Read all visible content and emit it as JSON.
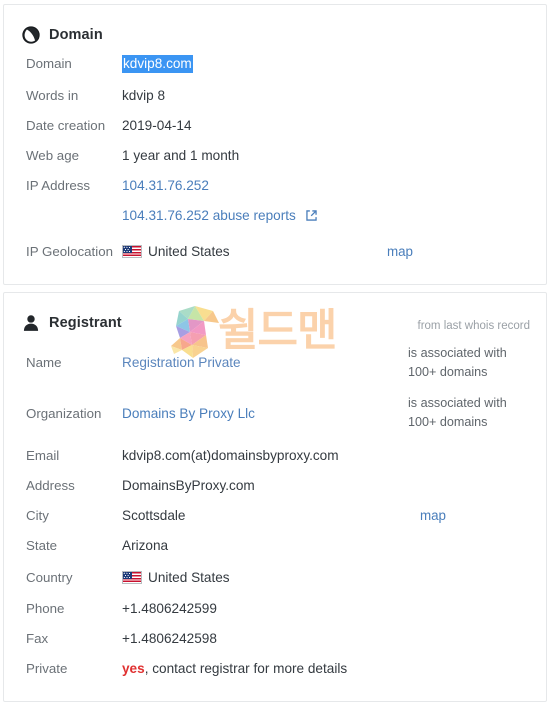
{
  "domain_section": {
    "icon": "globe-icon",
    "title": "Domain",
    "rows": [
      {
        "label": "Domain",
        "value": "kdvip8.com",
        "style": "selected"
      },
      {
        "label": "Words in",
        "value": "kdvip 8",
        "style": "plain"
      },
      {
        "label": "Date creation",
        "value": "2019-04-14",
        "style": "plain"
      },
      {
        "label": "Web age",
        "value": "1 year and 1 month",
        "style": "plain"
      },
      {
        "label": "IP Address",
        "value": "104.31.76.252",
        "style": "link"
      },
      {
        "label": "",
        "value": "104.31.76.252 abuse reports",
        "style": "link-external",
        "icon": "external-link-icon"
      },
      {
        "label": "IP Geolocation",
        "value": "United States",
        "style": "flag",
        "icon": "us-flag-icon",
        "map_label": "map"
      }
    ]
  },
  "registrant_section": {
    "icon": "user-icon",
    "title": "Registrant",
    "note": "from last whois record",
    "rows": [
      {
        "label": "Name",
        "value": "Registration Private",
        "style": "link-soft",
        "aside": "is associated with 100+ domains"
      },
      {
        "label": "Organization",
        "value": "Domains By Proxy Llc",
        "style": "link",
        "aside": "is associated with 100+ domains"
      },
      {
        "label": "Email",
        "value": "kdvip8.com(at)domainsbyproxy.com",
        "style": "plain"
      },
      {
        "label": "Address",
        "value": "DomainsByProxy.com",
        "style": "plain"
      },
      {
        "label": "City",
        "value": "Scottsdale",
        "style": "plain",
        "map_label": "map"
      },
      {
        "label": "State",
        "value": "Arizona",
        "style": "plain"
      },
      {
        "label": "Country",
        "value": "United States",
        "style": "flag",
        "icon": "us-flag-icon"
      },
      {
        "label": "Phone",
        "value": "+1.4806242599",
        "style": "plain"
      },
      {
        "label": "Fax",
        "value": "+1.4806242598",
        "style": "plain"
      },
      {
        "label": "Private",
        "value": "yes",
        "style": "red-prefix",
        "value_suffix": ", contact registrar for more details"
      }
    ]
  },
  "watermark": {
    "logo_letter": "S",
    "text": "쉴드맨",
    "color": "#f9b878"
  },
  "colors": {
    "link": "#4a7ebb",
    "selection": "#3b95f3",
    "label": "#6b7177",
    "value": "#343a40",
    "alert": "#e03131",
    "border": "#e6e8ea"
  }
}
